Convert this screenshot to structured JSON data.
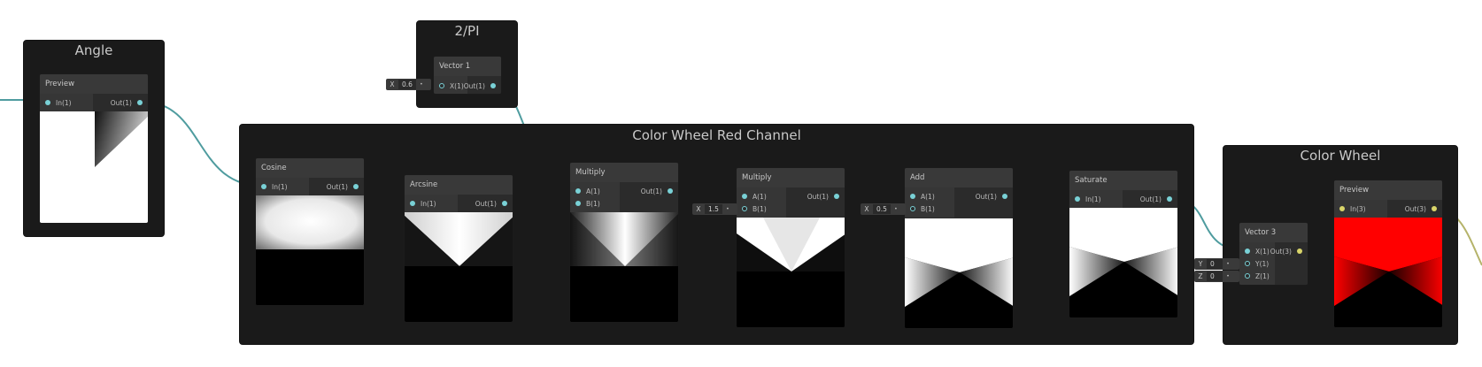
{
  "groups": {
    "angle": {
      "title": "Angle"
    },
    "two_over_pi": {
      "title": "2/PI"
    },
    "red_channel": {
      "title": "Color Wheel Red Channel"
    },
    "color_wheel": {
      "title": "Color Wheel"
    }
  },
  "nodes": {
    "angle_preview": {
      "title": "Preview",
      "in": "In(1)",
      "out": "Out(1)"
    },
    "vector1": {
      "title": "Vector 1",
      "in": "X(1)",
      "out": "Out(1)",
      "field_label": "X",
      "field_value": "0.6"
    },
    "cosine": {
      "title": "Cosine",
      "in": "In(1)",
      "out": "Out(1)"
    },
    "arcsine": {
      "title": "Arcsine",
      "in": "In(1)",
      "out": "Out(1)"
    },
    "multiply1": {
      "title": "Multiply",
      "in_a": "A(1)",
      "in_b": "B(1)",
      "out": "Out(1)"
    },
    "multiply2": {
      "title": "Multiply",
      "in_a": "A(1)",
      "in_b": "B(1)",
      "out": "Out(1)",
      "field_label": "X",
      "field_value": "1.5"
    },
    "add": {
      "title": "Add",
      "in_a": "A(1)",
      "in_b": "B(1)",
      "out": "Out(1)",
      "field_label": "X",
      "field_value": "0.5"
    },
    "saturate": {
      "title": "Saturate",
      "in": "In(1)",
      "out": "Out(1)"
    },
    "vector3": {
      "title": "Vector 3",
      "in_x": "X(1)",
      "in_y": "Y(1)",
      "in_z": "Z(1)",
      "out": "Out(3)",
      "field_y_label": "Y",
      "field_y_value": "0",
      "field_z_label": "Z",
      "field_z_value": "0"
    },
    "wheel_preview": {
      "title": "Preview",
      "in": "In(3)",
      "out": "Out(3)"
    }
  },
  "colors": {
    "wire_float": "#4f9c9f",
    "wire_vec3": "#b5b36a",
    "port_float": "#79d1d6",
    "port_vec3": "#d9d56a",
    "preview_red": "#ff0000"
  }
}
